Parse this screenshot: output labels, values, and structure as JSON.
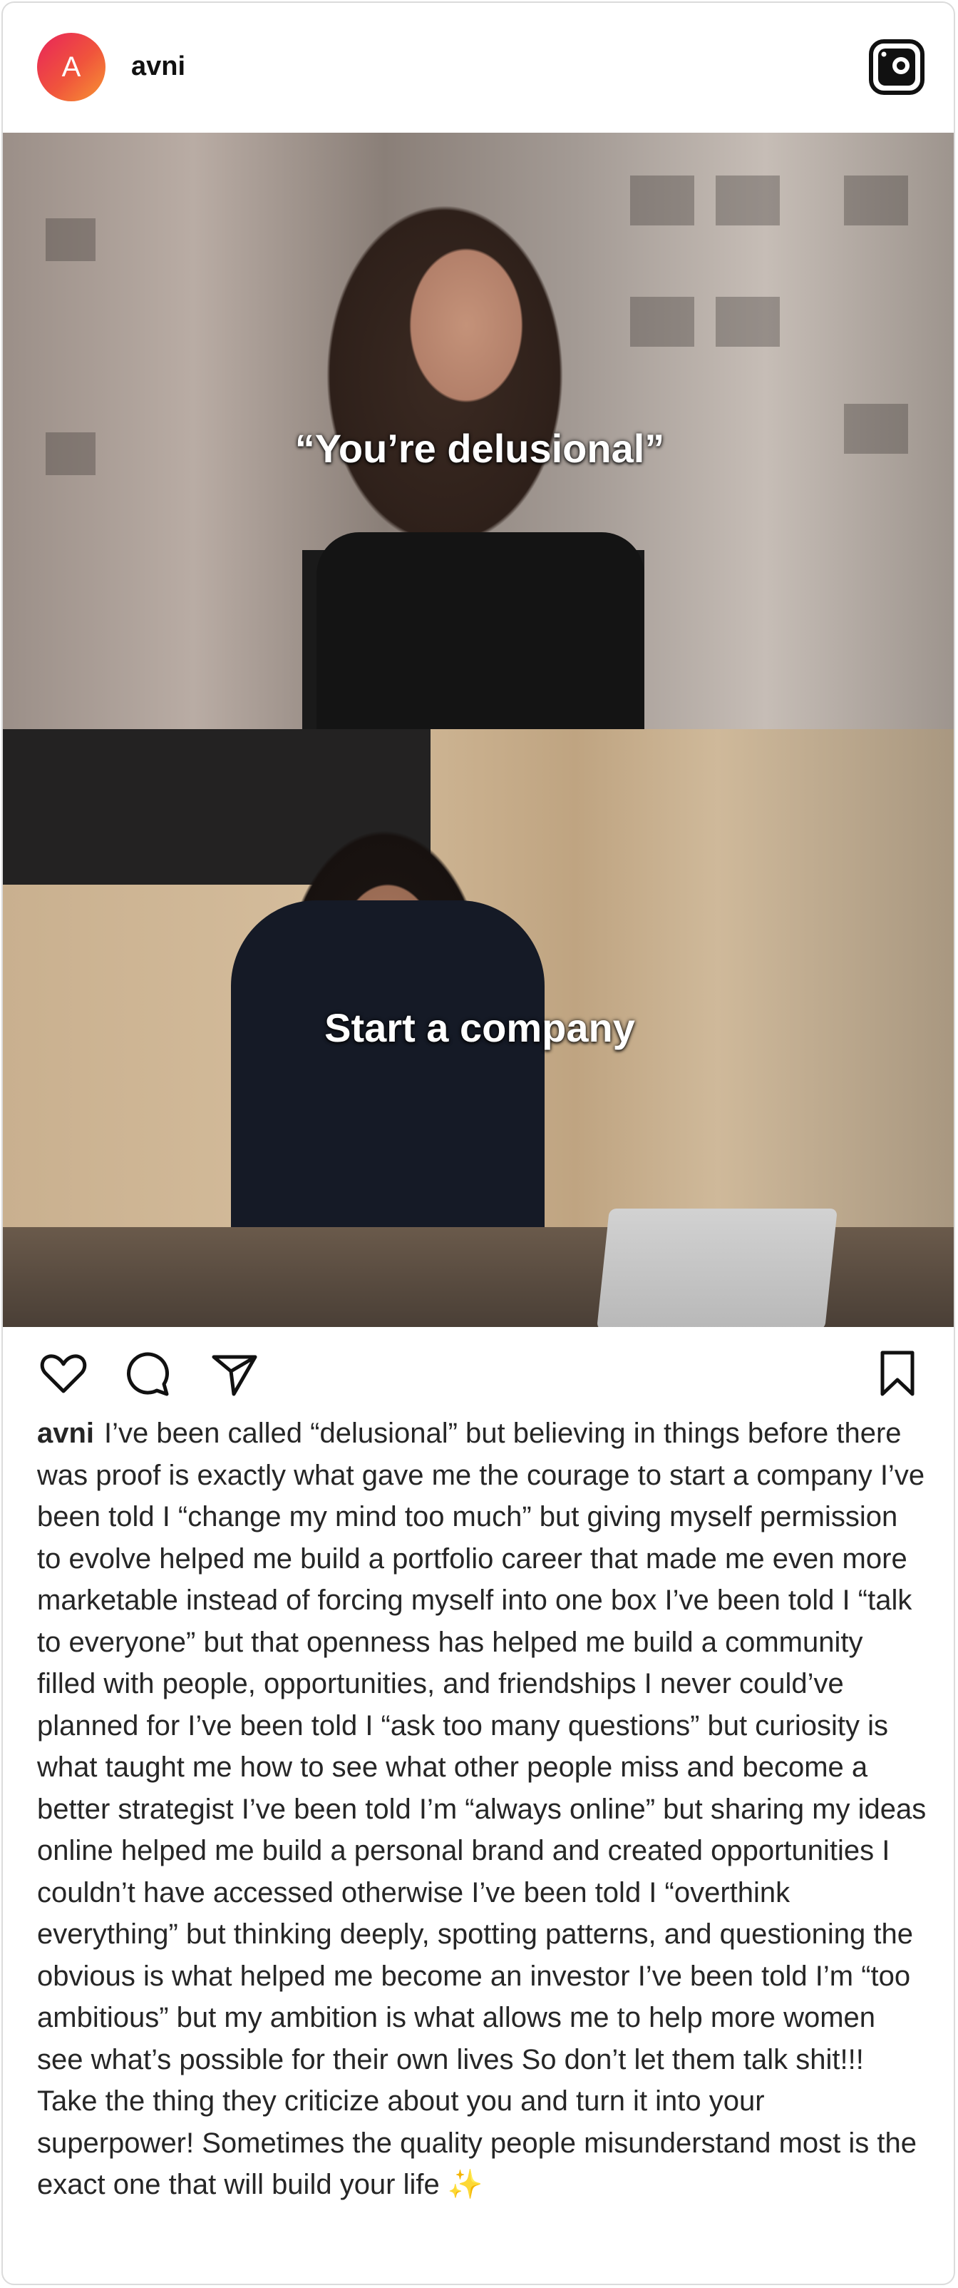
{
  "header": {
    "avatar_letter": "A",
    "username": "avni"
  },
  "images": [
    {
      "overlay_text": "“You’re delusional”"
    },
    {
      "overlay_text": "Start a company"
    }
  ],
  "actions": {
    "like": "heart-icon",
    "comment": "comment-icon",
    "share": "send-icon",
    "save": "bookmark-icon"
  },
  "caption": {
    "username": "avni",
    "text": "I’ve been called “delusional” but believing in things before there was proof is exactly what gave me the courage to start a company I’ve been told I “change my mind too much” but giving myself permission to evolve helped me build a portfolio career that made me even more marketable instead of forcing myself into one box I’ve been told I “talk to everyone” but that openness has helped me build a community filled with people, opportunities, and friendships I never could’ve planned for I’ve been told I “ask too many questions” but curiosity is what taught me how to see what other people miss and become a better strategist I’ve been told I’m “always online” but sharing my ideas online helped me build a personal brand and created opportunities I couldn’t have accessed otherwise I’ve been told I “overthink everything” but thinking deeply, spotting patterns, and questioning the obvious is what helped me become an investor I’ve been told I’m “too ambitious” but my ambition is what allows me to help more women see what’s possible for their own lives So don’t let them talk shit!!! Take the thing they criticize about you and turn it into your superpower! Sometimes the quality people misunderstand most is the exact one that will build your life ✨"
  },
  "colors": {
    "avatar_gradient_start": "#e8245a",
    "avatar_gradient_end": "#f79533",
    "text": "#262626",
    "border": "#dbdbdb"
  }
}
